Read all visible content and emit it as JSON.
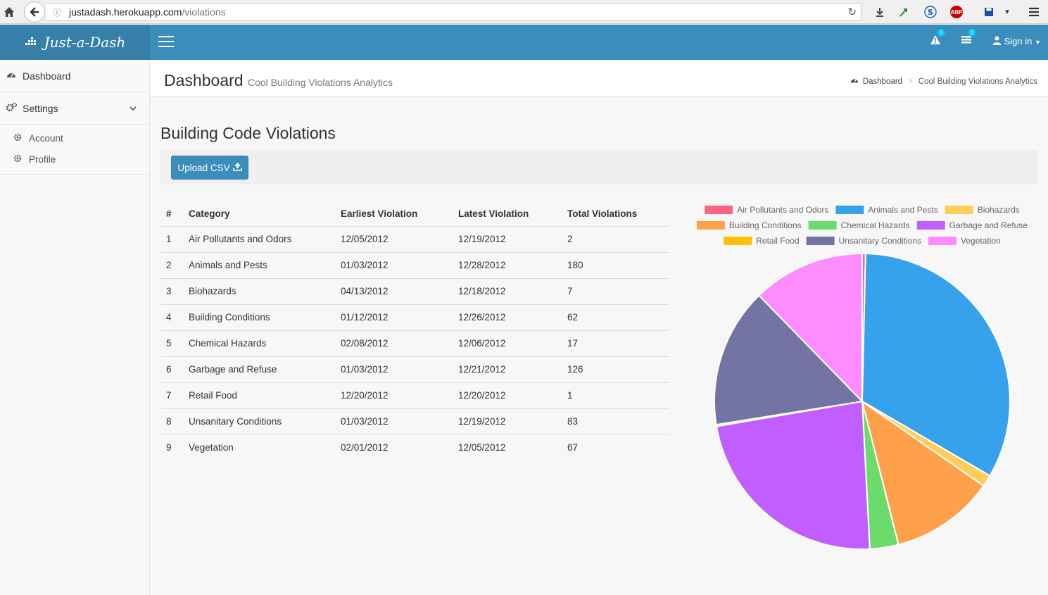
{
  "browser": {
    "url_host": "justadash.herokuapp.com",
    "url_path": "/violations"
  },
  "app": {
    "brand": "Just-a-Dash",
    "alerts_count": "0",
    "tasks_count": "0",
    "signin_label": "Sign in"
  },
  "sidebar": {
    "items": [
      {
        "label": "Dashboard",
        "icon": "dashboard-icon"
      },
      {
        "label": "Settings",
        "icon": "cogs-icon"
      }
    ],
    "sub_items": [
      {
        "label": "Account",
        "icon": "gear-icon"
      },
      {
        "label": "Profile",
        "icon": "gear-icon"
      }
    ]
  },
  "header": {
    "title": "Dashboard",
    "subtitle": "Cool Building Violations Analytics",
    "breadcrumb": [
      "Dashboard",
      "Cool Building Violations Analytics"
    ]
  },
  "main": {
    "section_title": "Building Code Violations",
    "upload_label": "Upload CSV"
  },
  "table": {
    "headers": [
      "#",
      "Category",
      "Earliest Violation",
      "Latest Violation",
      "Total Violations"
    ],
    "rows": [
      [
        "1",
        "Air Pollutants and Odors",
        "12/05/2012",
        "12/19/2012",
        "2"
      ],
      [
        "2",
        "Animals and Pests",
        "01/03/2012",
        "12/28/2012",
        "180"
      ],
      [
        "3",
        "Biohazards",
        "04/13/2012",
        "12/18/2012",
        "7"
      ],
      [
        "4",
        "Building Conditions",
        "01/12/2012",
        "12/26/2012",
        "62"
      ],
      [
        "5",
        "Chemical Hazards",
        "02/08/2012",
        "12/06/2012",
        "17"
      ],
      [
        "6",
        "Garbage and Refuse",
        "01/03/2012",
        "12/21/2012",
        "126"
      ],
      [
        "7",
        "Retail Food",
        "12/20/2012",
        "12/20/2012",
        "1"
      ],
      [
        "8",
        "Unsanitary Conditions",
        "01/03/2012",
        "12/19/2012",
        "83"
      ],
      [
        "9",
        "Vegetation",
        "02/01/2012",
        "12/05/2012",
        "67"
      ]
    ]
  },
  "chart_data": {
    "type": "pie",
    "categories": [
      "Air Pollutants and Odors",
      "Animals and Pests",
      "Biohazards",
      "Building Conditions",
      "Chemical Hazards",
      "Garbage and Refuse",
      "Retail Food",
      "Unsanitary Conditions",
      "Vegetation"
    ],
    "values": [
      2,
      180,
      7,
      62,
      17,
      126,
      1,
      83,
      67
    ],
    "colors": [
      "#ff6384",
      "#36a2eb",
      "#ffce56",
      "#ffa14a",
      "#6bdc6b",
      "#c15eff",
      "#ffc107",
      "#7474a4",
      "#ff8cff"
    ],
    "legend": "top"
  }
}
